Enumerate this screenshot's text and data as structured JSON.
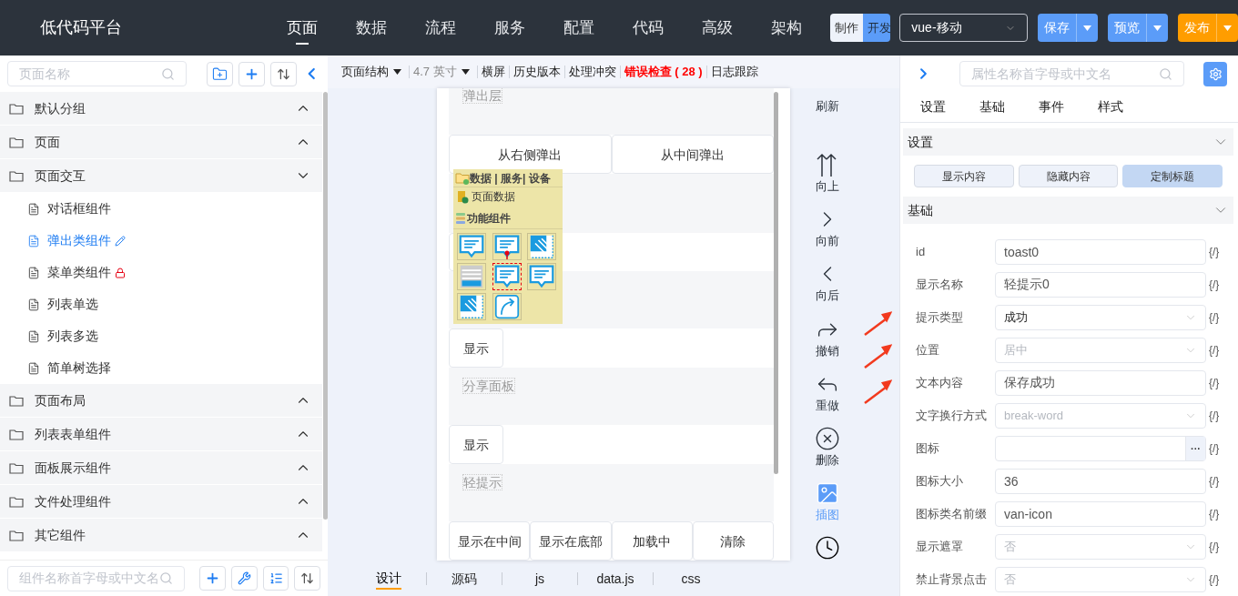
{
  "header": {
    "title": "低代码平台",
    "nav": [
      {
        "label": "页面",
        "selected": true
      },
      {
        "label": "数据",
        "selected": false
      },
      {
        "label": "流程",
        "selected": false
      },
      {
        "label": "服务",
        "selected": false
      },
      {
        "label": "配置",
        "selected": false
      },
      {
        "label": "代码",
        "selected": false
      },
      {
        "label": "高级",
        "selected": false
      },
      {
        "label": "架构",
        "selected": false
      }
    ],
    "mode_toggle": [
      {
        "label": "制作",
        "selected": false
      },
      {
        "label": "开发",
        "selected": true
      }
    ],
    "platform_select": {
      "value": "vue-移动"
    },
    "actions": [
      {
        "label": "保存",
        "kind": "primary"
      },
      {
        "label": "预览",
        "kind": "primary"
      },
      {
        "label": "发布",
        "kind": "warning"
      }
    ]
  },
  "left_panel": {
    "search": {
      "placeholder": "页面名称"
    },
    "tree": [
      {
        "label": "默认分组",
        "expanded": false
      },
      {
        "label": "页面",
        "expanded": false
      },
      {
        "label": "页面交互",
        "expanded": true,
        "children": [
          {
            "label": "对话框组件",
            "selected": false
          },
          {
            "label": "弹出类组件",
            "selected": true,
            "kind": "editing"
          },
          {
            "label": "菜单类组件",
            "selected": false,
            "kind": "locked"
          },
          {
            "label": "列表单选",
            "selected": false
          },
          {
            "label": "列表多选",
            "selected": false
          },
          {
            "label": "简单树选择",
            "selected": false
          }
        ]
      },
      {
        "label": "页面布局",
        "expanded": false
      },
      {
        "label": "列表表单组件",
        "expanded": false
      },
      {
        "label": "面板展示组件",
        "expanded": false
      },
      {
        "label": "文件处理组件",
        "expanded": false
      },
      {
        "label": "其它组件",
        "expanded": false
      }
    ],
    "component_search": {
      "placeholder": "组件名称首字母或中文名"
    }
  },
  "canvas": {
    "toolbar": [
      {
        "label": "页面结构",
        "kind": "dropdown"
      },
      {
        "label": "4.7 英寸",
        "kind": "dropdown-muted"
      },
      {
        "label": "横屏",
        "kind": "link"
      },
      {
        "label": "历史版本",
        "kind": "link"
      },
      {
        "label": "处理冲突",
        "kind": "link"
      },
      {
        "label": "错误检查 ( 28 )",
        "kind": "error"
      },
      {
        "label": "日志跟踪",
        "kind": "link"
      }
    ],
    "phone": [
      {
        "kind": "label",
        "text": "弹出层"
      },
      {
        "kind": "buttons",
        "buttons": [
          "从右侧弹出",
          "从中间弹出"
        ]
      },
      {
        "kind": "covered"
      },
      {
        "kind": "buttons",
        "buttons": [
          "显示"
        ]
      },
      {
        "kind": "label",
        "text": "分享面板"
      },
      {
        "kind": "buttons",
        "buttons": [
          "显示"
        ]
      },
      {
        "kind": "label",
        "text": "轻提示"
      },
      {
        "kind": "buttons",
        "buttons": [
          "显示在中间",
          "显示在底部",
          "加载中",
          "清除"
        ]
      }
    ],
    "palette": {
      "header": "数据 | 服务| 设备",
      "data_item": "页面数据",
      "group": "功能组件",
      "items": [
        {
          "kind": "bubble",
          "selected": false
        },
        {
          "kind": "bubble-pin",
          "selected": false
        },
        {
          "kind": "stripes",
          "selected": false
        },
        {
          "kind": "bars",
          "selected": false
        },
        {
          "kind": "bubble",
          "selected": true
        },
        {
          "kind": "bubble",
          "selected": false
        },
        {
          "kind": "stripes",
          "selected": false
        },
        {
          "kind": "share",
          "selected": false
        }
      ]
    },
    "tools": [
      {
        "label": "刷新",
        "kind": "refresh",
        "active": false
      },
      {
        "label": "向上",
        "kind": "up",
        "active": false
      },
      {
        "label": "向前",
        "kind": "forward",
        "active": false
      },
      {
        "label": "向后",
        "kind": "back",
        "active": false
      },
      {
        "label": "撤销",
        "kind": "undo",
        "active": false
      },
      {
        "label": "重做",
        "kind": "redo",
        "active": false
      },
      {
        "label": "删除",
        "kind": "delete",
        "active": false
      },
      {
        "label": "插图",
        "kind": "image",
        "active": true
      }
    ],
    "bottom_tabs": [
      {
        "label": "设计",
        "selected": true
      },
      {
        "label": "源码",
        "selected": false
      },
      {
        "label": "js",
        "selected": false
      },
      {
        "label": "data.js",
        "selected": false
      },
      {
        "label": "css",
        "selected": false
      }
    ]
  },
  "properties": {
    "search": {
      "placeholder": "属性名称首字母或中文名"
    },
    "tabs": [
      "设置",
      "基础",
      "事件",
      "样式"
    ],
    "settings_section": {
      "title": "设置",
      "expanded": true,
      "buttons": [
        {
          "label": "显示内容",
          "selected": false
        },
        {
          "label": "隐藏内容",
          "selected": false
        },
        {
          "label": "定制标题",
          "selected": true
        }
      ]
    },
    "basic_section": {
      "title": "基础",
      "expanded": true,
      "fields": [
        {
          "label": "id",
          "kind": "input",
          "value": "toast0",
          "expr": "{/}"
        },
        {
          "label": "显示名称",
          "kind": "input",
          "value": "轻提示0",
          "expr": "{/}"
        },
        {
          "label": "提示类型",
          "kind": "select",
          "value": "成功",
          "expr": "{/}"
        },
        {
          "label": "位置",
          "kind": "select",
          "placeholder": "居中",
          "expr": "{/}"
        },
        {
          "label": "文本内容",
          "kind": "input",
          "value": "保存成功",
          "expr": "{/}"
        },
        {
          "label": "文字换行方式",
          "kind": "select",
          "placeholder": "break-word",
          "expr": "{/}"
        },
        {
          "label": "图标",
          "kind": "picker",
          "picker": "···",
          "expr": "{/}"
        },
        {
          "label": "图标大小",
          "kind": "input",
          "value": "36",
          "expr": "{/}"
        },
        {
          "label": "图标类名前缀",
          "kind": "input",
          "value": "van-icon",
          "expr": "{/}"
        },
        {
          "label": "显示遮罩",
          "kind": "select",
          "placeholder": "否",
          "expr": "{/}"
        },
        {
          "label": "禁止背景点击",
          "kind": "select",
          "placeholder": "否",
          "expr": "{/}"
        }
      ]
    }
  }
}
